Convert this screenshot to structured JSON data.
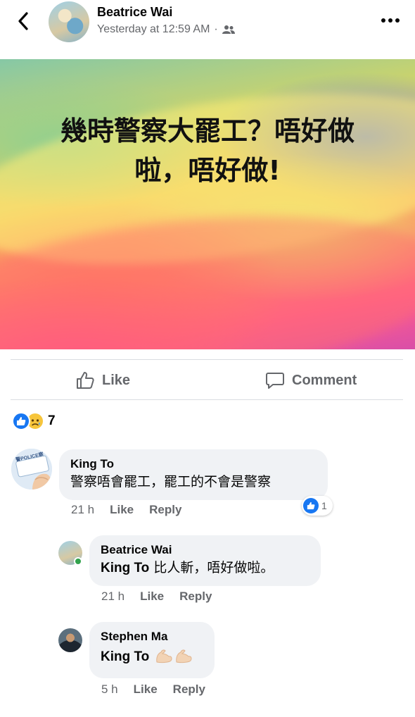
{
  "header": {
    "poster_name": "Beatrice Wai",
    "timestamp": "Yesterday at 12:59 AM",
    "separator": "·",
    "audience_icon": "friends-icon",
    "back_icon": "chevron-left-icon",
    "more_icon": "more-dots-icon"
  },
  "post": {
    "text_line1": "幾時警察大罷工？唔好做",
    "text_line2": "啦，唔好做!"
  },
  "actions": {
    "like_label": "Like",
    "comment_label": "Comment"
  },
  "reactions": {
    "types": [
      "like",
      "sad"
    ],
    "count": "7"
  },
  "comments": [
    {
      "author": "King To",
      "text": "警察唔會罷工，罷工的不會是警察",
      "time": "21 h",
      "like_label": "Like",
      "reply_label": "Reply",
      "reaction_count": "1",
      "avatar_text": "警POLICE察"
    },
    {
      "author": "Beatrice Wai",
      "mention": "King To",
      "text": " 比人斬，唔好做啦。",
      "time": "21 h",
      "like_label": "Like",
      "reply_label": "Reply"
    },
    {
      "author": "Stephen Ma",
      "mention": "King To",
      "emoji": "flexed-biceps-icon",
      "time": "5 h",
      "like_label": "Like",
      "reply_label": "Reply"
    }
  ],
  "colors": {
    "accent": "#1877f2",
    "secondary_text": "#65676b",
    "bubble": "#f0f2f5",
    "online": "#31a24c"
  }
}
